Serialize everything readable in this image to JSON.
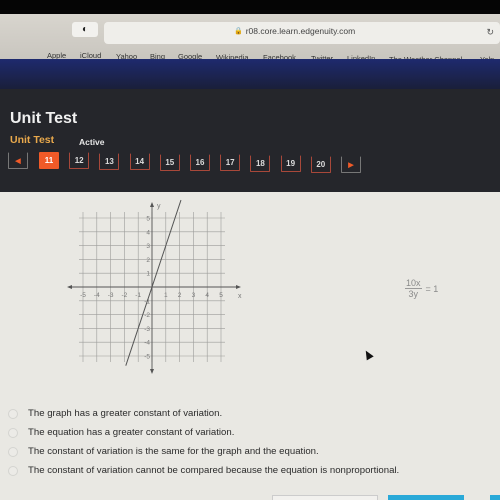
{
  "browser": {
    "url": "r08.core.learn.edgenuity.com",
    "bookmarks": [
      "Apple",
      "iCloud",
      "Yahoo",
      "Bing",
      "Google",
      "Wikipedia",
      "Facebook",
      "Twitter",
      "LinkedIn",
      "The Weather Channel",
      "Yelp"
    ]
  },
  "header": {
    "title": "Unit Test",
    "subtitle": "Unit Test",
    "status": "Active"
  },
  "pager": {
    "prev_icon": "left-triangle",
    "next_icon": "right-triangle",
    "pages": [
      "11",
      "12",
      "13",
      "14",
      "15",
      "16",
      "17",
      "18",
      "19",
      "20"
    ],
    "active_page": "11"
  },
  "question": {
    "equation": {
      "numerator": "10x",
      "denominator": "3y",
      "rhs": "= 1"
    },
    "choices": [
      "The graph has a greater constant of variation.",
      "The equation has a greater constant of variation.",
      "The constant of variation is the same for the graph and the equation.",
      "The constant of variation cannot be compared because the equation is nonproportional."
    ]
  },
  "chart_data": {
    "type": "line",
    "xlabel": "x",
    "ylabel": "y",
    "xlim": [
      -5,
      5
    ],
    "ylim": [
      -5,
      5
    ],
    "x_ticks": [
      "-5",
      "-4",
      "-3",
      "-2",
      "-1",
      "1",
      "2",
      "3",
      "4",
      "5"
    ],
    "y_ticks": [
      "5",
      "4",
      "3",
      "2",
      "1",
      "-1",
      "-2",
      "-3",
      "-4",
      "-5"
    ],
    "grid": true,
    "series": [
      {
        "name": "line",
        "slope": 3,
        "intercept": 0,
        "points": [
          [
            -1.9,
            -5.7
          ],
          [
            0,
            0
          ],
          [
            1,
            3
          ],
          [
            2.1,
            6.3
          ]
        ]
      }
    ]
  }
}
